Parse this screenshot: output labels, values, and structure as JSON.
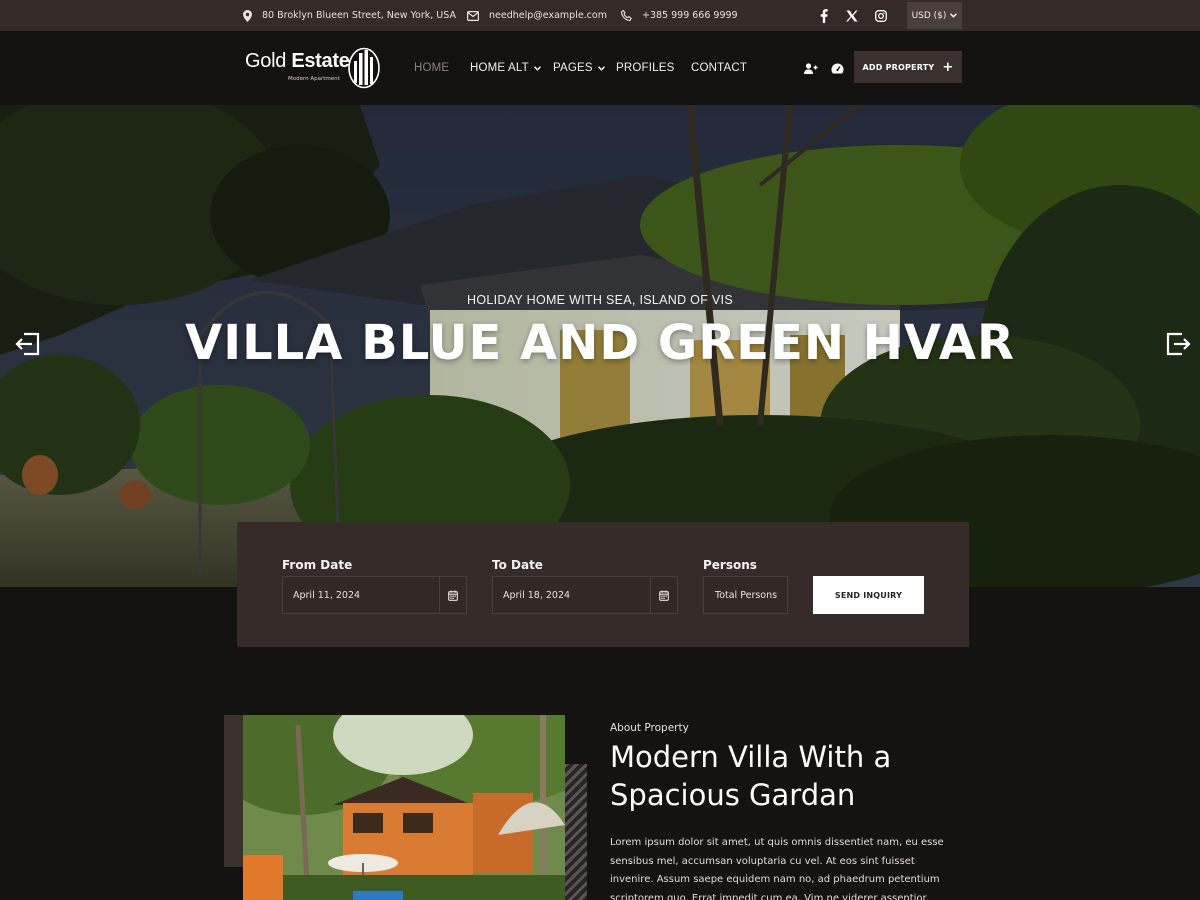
{
  "topbar": {
    "address": "80 Broklyn Blueen Street, New York, USA",
    "email": "needhelp@example.com",
    "phone": "+385 999 666 9999",
    "social": [
      "facebook-icon",
      "x-icon",
      "instagram-icon"
    ],
    "currency": "USD ($)"
  },
  "nav": {
    "logo_main": "Gold",
    "logo_bold": "Estate",
    "logo_sub": "Modern Apartment",
    "links": [
      {
        "label": "HOME",
        "active": true
      },
      {
        "label": "HOME ALT",
        "dropdown": true
      },
      {
        "label": "PAGES",
        "dropdown": true
      },
      {
        "label": "PROFILES"
      },
      {
        "label": "CONTACT"
      }
    ],
    "add_property": "ADD PROPERTY"
  },
  "hero": {
    "kicker": "HOLIDAY HOME WITH SEA, ISLAND OF VIS",
    "title": "VILLA BLUE AND GREEN HVAR"
  },
  "booking": {
    "from_label": "From Date",
    "from_value": "April 11, 2024",
    "to_label": "To Date",
    "to_value": "April 18, 2024",
    "persons_label": "Persons",
    "persons_placeholder": "Total Persons",
    "send_label": "SEND INQUIRY"
  },
  "about": {
    "kicker": "About Property",
    "title": "Modern Villa With a Spacious Gardan",
    "text": "Lorem ipsum dolor sit amet, ut quis omnis dissentiet nam, eu esse sensibus mel, accumsan voluptaria cu vel. At eos sint fuisset invenire. Assum saepe equidem nam no, ad phaedrum petentium scriptorem quo. Errat impedit cum ea. Vim ne viderer assentior."
  },
  "colors": {
    "topbar_bg": "#342a28",
    "nav_bg": "#141111",
    "panel_bg": "#352b29",
    "page_bg": "#151212"
  }
}
